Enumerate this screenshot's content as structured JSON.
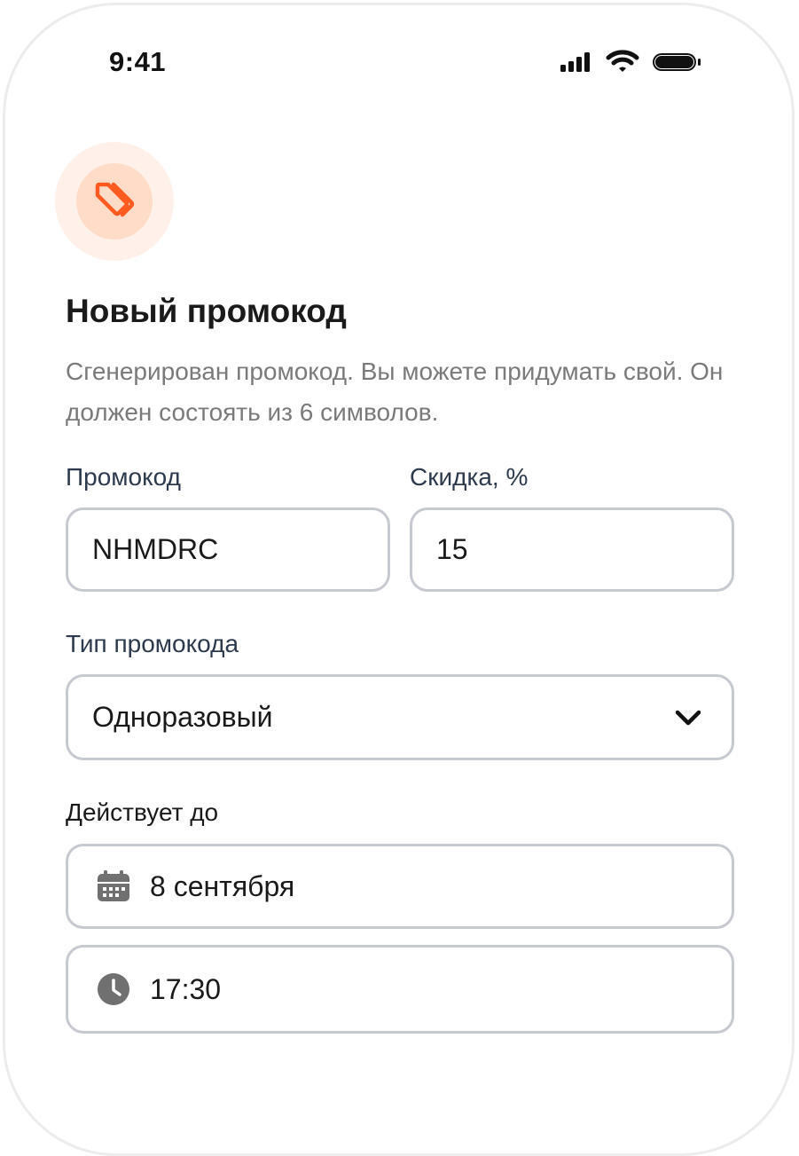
{
  "status_bar": {
    "time": "9:41",
    "icons": [
      "signal-icon",
      "wifi-icon",
      "battery-icon"
    ]
  },
  "header": {
    "icon": "tag-icon",
    "title": "Новый промокод",
    "description": "Сгенерирован промокод. Вы можете придумать свой. Он должен состоять из 6 символов."
  },
  "form": {
    "promo_code": {
      "label": "Промокод",
      "value": "NHMDRC"
    },
    "discount": {
      "label": "Скидка, %",
      "value": "15"
    },
    "promo_type": {
      "label": "Тип промокода",
      "value": "Одноразовый"
    },
    "valid_until": {
      "label": "Действует до",
      "date": "8 сентября",
      "time": "17:30"
    }
  },
  "colors": {
    "accent": "#ff5a1f",
    "badge_outer": "#fff1ea",
    "badge_inner": "#ffdcc8",
    "border": "#c7c9d1",
    "label": "#2d3a4e",
    "muted": "#7a7a7a"
  }
}
